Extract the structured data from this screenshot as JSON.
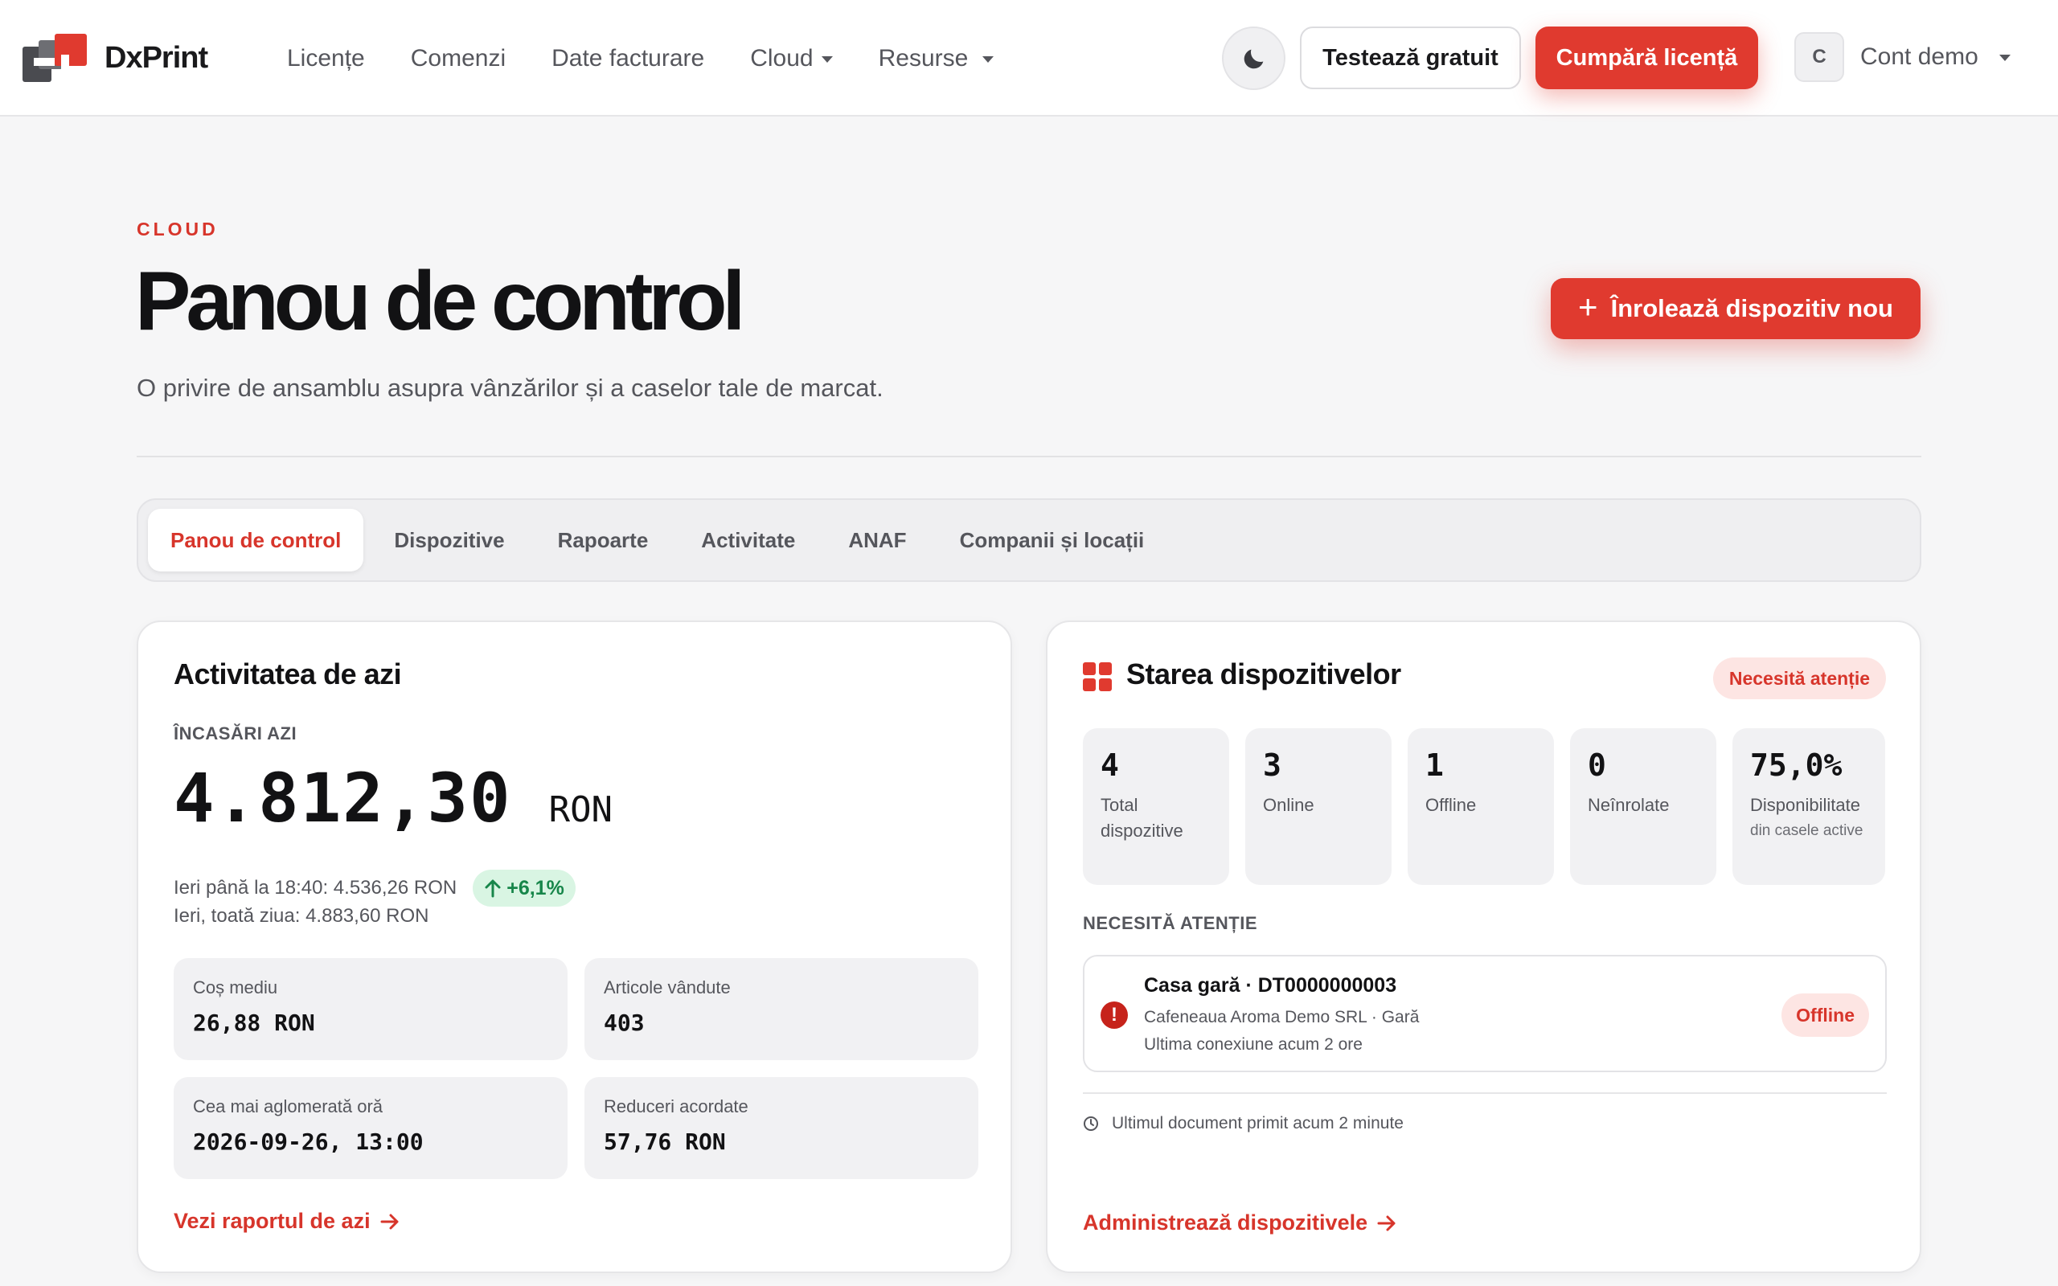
{
  "brand": {
    "name": "DxPrint",
    "accent": "#e03a2f"
  },
  "nav": {
    "items": [
      {
        "label": "Licențe",
        "dropdown": false
      },
      {
        "label": "Comenzi",
        "dropdown": false
      },
      {
        "label": "Date facturare",
        "dropdown": false
      },
      {
        "label": "Cloud",
        "dropdown": true
      },
      {
        "label": "Resurse",
        "dropdown": true
      }
    ],
    "theme_icon": "moon-icon",
    "try_free": "Testează gratuit",
    "buy_license": "Cumpără licență",
    "account": {
      "initial": "C",
      "name": "Cont demo"
    }
  },
  "header": {
    "eyebrow": "CLOUD",
    "title": "Panou de control",
    "subtitle": "O privire de ansamblu asupra vânzărilor și a caselor tale de marcat.",
    "enroll_button": "Înrolează dispozitiv nou"
  },
  "tabs": [
    {
      "label": "Panou de control",
      "active": true
    },
    {
      "label": "Dispozitive",
      "active": false
    },
    {
      "label": "Rapoarte",
      "active": false
    },
    {
      "label": "Activitate",
      "active": false
    },
    {
      "label": "ANAF",
      "active": false
    },
    {
      "label": "Companii și locații",
      "active": false
    }
  ],
  "activity": {
    "title": "Activitatea de azi",
    "income_label": "ÎNCASĂRI AZI",
    "income_value": "4.812,30",
    "income_currency": "RON",
    "yesterday_until": "Ieri până la 18:40: 4.536,26 RON",
    "delta": "+6,1%",
    "yesterday_full": "Ieri, toată ziua: 4.883,60 RON",
    "stats": [
      {
        "label": "Coș mediu",
        "value": "26,88 RON"
      },
      {
        "label": "Articole vândute",
        "value": "403"
      },
      {
        "label": "Cea mai aglomerată oră",
        "value": "2026-09-26, 13:00"
      },
      {
        "label": "Reduceri acordate",
        "value": "57,76 RON"
      }
    ],
    "link": "Vezi raportul de azi"
  },
  "devices": {
    "title": "Starea dispozitivelor",
    "badge": "Necesită atenție",
    "metrics": [
      {
        "value": "4",
        "label": "Total dispozitive",
        "sub": ""
      },
      {
        "value": "3",
        "label": "Online",
        "sub": ""
      },
      {
        "value": "1",
        "label": "Offline",
        "sub": ""
      },
      {
        "value": "0",
        "label": "Neînrolate",
        "sub": ""
      },
      {
        "value": "75,0%",
        "label": "Disponibilitate",
        "sub": "din casele active"
      }
    ],
    "attention_label": "NECESITĂ ATENȚIE",
    "alert": {
      "title": "Casa gară · DT0000000003",
      "company": "Cafeneaua Aroma Demo SRL · Gară",
      "last_connection": "Ultima conexiune acum 2 ore",
      "status": "Offline"
    },
    "last_document": "Ultimul document primit acum 2 minute",
    "link": "Administrează dispozitivele"
  }
}
